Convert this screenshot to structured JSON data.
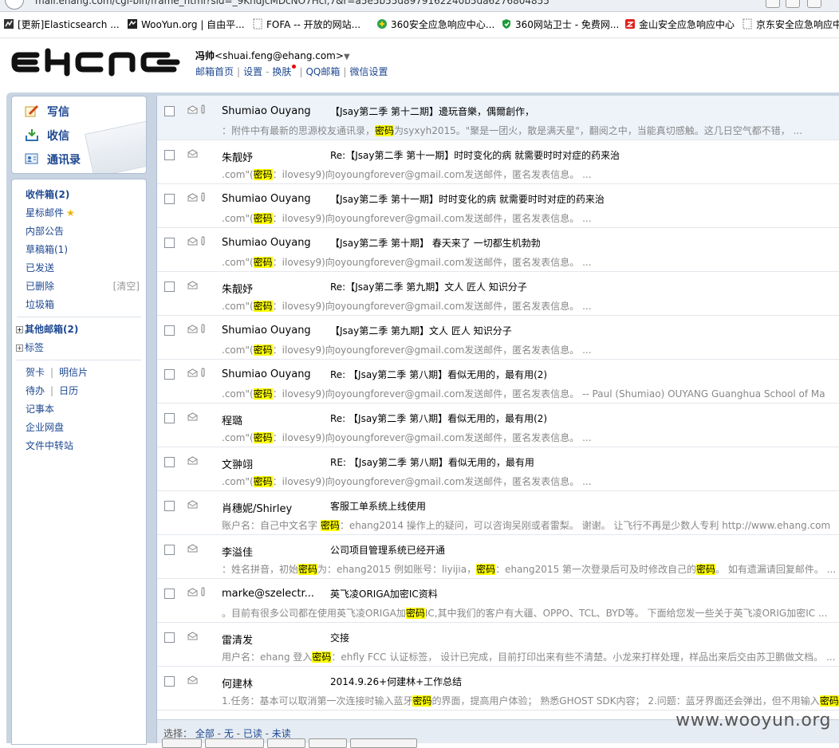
{
  "browser": {
    "url": "mail.ehang.com/cgi-bin/frame_html?sid=_9KhdJcMDcNO7Hcl,7&r=a5e5b55d8979162240b5da6276804855",
    "bookmarks": [
      {
        "label": "[更新]Elasticsearch ...",
        "icon": "app-icon"
      },
      {
        "label": "WooYun.org | 自由平...",
        "icon": "wooyun-icon"
      },
      {
        "label": "FOFA -- 开放的网站...",
        "icon": "page-icon"
      },
      {
        "label": "360安全应急响应中心...",
        "icon": "360-icon"
      },
      {
        "label": "360网站卫士 - 免费网...",
        "icon": "shield-icon"
      },
      {
        "label": "金山安全应急响应中心",
        "icon": "kingsoft-icon"
      },
      {
        "label": "京东安全应急响应中心",
        "icon": "page-icon"
      }
    ]
  },
  "header": {
    "user_name": "冯帅",
    "user_email": "<shuai.feng@ehang.com>",
    "links": [
      "邮箱首页",
      "设置",
      "换肤",
      "QQ邮箱",
      "微信设置"
    ]
  },
  "quick": {
    "compose": "写信",
    "receive": "收信",
    "contacts": "通讯录"
  },
  "folders": {
    "inbox": "收件箱(2)",
    "starred": "星标邮件",
    "internal": "内部公告",
    "drafts": "草稿箱(1)",
    "sent": "已发送",
    "deleted": "已删除",
    "clear": "[清空]",
    "spam": "垃圾箱",
    "other": "其他邮箱(2)",
    "tags": "标签",
    "card": "贺卡",
    "postcard": "明信片",
    "todo": "待办",
    "calendar": "日历",
    "notes": "记事本",
    "disk": "企业网盘",
    "transfer": "文件中转站"
  },
  "mails": [
    {
      "sender": "Shumiao Ouyang",
      "attach": true,
      "subject": "【Jsay第二季 第十二期】邊玩音樂，偶爾創作，",
      "preview": [
        [
          "：附件中有最新的思源校友通讯录，",
          false
        ],
        [
          "密码",
          true
        ],
        [
          "为syxyh2015。\"聚是一团火，散是满天星\"，翻阅之中，当能真切感触。这几日空气都不错，  ...",
          false
        ]
      ]
    },
    {
      "sender": "朱靓妤",
      "attach": false,
      "subject": "Re:【Jsay第二季 第十一期】时时变化的病 就需要时时对症的药来治",
      "preview": [
        [
          ".com\"(",
          false
        ],
        [
          "密码",
          true
        ],
        [
          "：ilovesy9)向oyoungforever@gmail.com发送邮件，匿名发表信息。  ...",
          false
        ]
      ]
    },
    {
      "sender": "Shumiao Ouyang",
      "attach": true,
      "subject": "【Jsay第二季 第十一期】时时变化的病 就需要时时对症的药来治",
      "preview": [
        [
          ".com\"(",
          false
        ],
        [
          "密码",
          true
        ],
        [
          "：ilovesy9)向oyoungforever@gmail.com发送邮件，匿名发表信息。  ...",
          false
        ]
      ]
    },
    {
      "sender": "Shumiao Ouyang",
      "attach": true,
      "subject": "【Jsay第二季 第十期】 春天来了 一切都生机勃勃",
      "preview": [
        [
          ".com\"(",
          false
        ],
        [
          "密码",
          true
        ],
        [
          "：ilovesy9)向oyoungforever@gmail.com发送邮件，匿名发表信息。  ...",
          false
        ]
      ]
    },
    {
      "sender": "朱靓妤",
      "attach": false,
      "subject": "Re:【Jsay第二季 第九期】文人 匠人 知识分子",
      "preview": [
        [
          ".com\"(",
          false
        ],
        [
          "密码",
          true
        ],
        [
          "：ilovesy9)向oyoungforever@gmail.com发送邮件，匿名发表信息。  ...",
          false
        ]
      ]
    },
    {
      "sender": "Shumiao Ouyang",
      "attach": true,
      "subject": "【Jsay第二季 第九期】文人 匠人 知识分子",
      "preview": [
        [
          ".com\"(",
          false
        ],
        [
          "密码",
          true
        ],
        [
          "：ilovesy9)向oyoungforever@gmail.com发送邮件，匿名发表信息。  ...",
          false
        ]
      ]
    },
    {
      "sender": "Shumiao Ouyang",
      "attach": true,
      "subject": "Re: 【Jsay第二季 第八期】看似无用的，最有用(2)",
      "preview": [
        [
          ".com\"(",
          false
        ],
        [
          "密码",
          true
        ],
        [
          "：ilovesy9)向oyoungforever@gmail.com发送邮件，匿名发表信息。 -- Paul (Shumiao) OUYANG Guanghua School of Ma",
          false
        ]
      ]
    },
    {
      "sender": "程璐",
      "attach": false,
      "subject": "Re: 【Jsay第二季 第八期】看似无用的，最有用(2)",
      "preview": [
        [
          ".com\"(",
          false
        ],
        [
          "密码",
          true
        ],
        [
          "：ilovesy9)向oyoungforever@gmail.com发送邮件，匿名发表信息。  ...",
          false
        ]
      ]
    },
    {
      "sender": "文翀翊",
      "attach": false,
      "subject": "RE: 【Jsay第二季 第八期】看似无用的，最有用",
      "preview": [
        [
          ".com\"(",
          false
        ],
        [
          "密码",
          true
        ],
        [
          "：ilovesy9)向oyoungforever@gmail.com发送邮件，匿名发表信息。  ...",
          false
        ]
      ]
    },
    {
      "sender": "肖穗妮/Shirley",
      "attach": false,
      "subject": "客服工单系统上线使用",
      "preview": [
        [
          "账户名：自己中文名字 ",
          false
        ],
        [
          "密码",
          true
        ],
        [
          "：ehang2014 操作上的疑问，可以咨询吴刚或者雷梨。 谢谢。 让飞行不再是少数人专利 http://www.ehang.com",
          false
        ]
      ]
    },
    {
      "sender": "李溢佳",
      "attach": false,
      "subject": "公司项目管理系统已经开通",
      "preview": [
        [
          "：姓名拼音，初始",
          false
        ],
        [
          "密码",
          true
        ],
        [
          "为：ehang2015 例如账号：liyijia，",
          false
        ],
        [
          "密码",
          true
        ],
        [
          "：ehang2015 第一次登录后可及时修改自己的",
          false
        ],
        [
          "密码",
          true
        ],
        [
          "。 如有遗漏请回复邮件。  ...",
          false
        ]
      ]
    },
    {
      "sender": "marke@szelectr...",
      "attach": true,
      "subject": "英飞凌ORIGA加密IC资料",
      "preview": [
        [
          "。目前有很多公司都在使用英飞凌ORIGA加",
          false
        ],
        [
          "密码",
          true
        ],
        [
          "IC,其中我们的客户有大疆、OPPO、TCL、BYD等。 下面给您发一些关于英飞凌ORIG加密IC ...",
          false
        ]
      ]
    },
    {
      "sender": "雷清发",
      "attach": false,
      "subject": "交接",
      "preview": [
        [
          "用户名：ehang 登入",
          false
        ],
        [
          "密码",
          true
        ],
        [
          "：ehfly FCC 认证标签， 设计已完成，目前打印出来有些不清楚。小龙来打样处理，样品出来后交由苏卫鹏做文档。  ...",
          false
        ]
      ]
    },
    {
      "sender": "何建林",
      "attach": false,
      "subject": "2014.9.26+何建林+工作总结",
      "preview": [
        [
          "1.任务：基本可以取消第一次连接时输入蓝牙",
          false
        ],
        [
          "密码",
          true
        ],
        [
          "的界面，提高用户体验； 熟悉GHOST SDK内容； 2.问题：蓝牙界面还会弹出，但不用输入",
          false
        ],
        [
          "密码",
          true
        ]
      ]
    }
  ],
  "selbar": {
    "label": "选择：",
    "all": "全部",
    "none": "无",
    "read": "已读",
    "unread": "未读"
  },
  "watermark": "www.wooyun.org"
}
